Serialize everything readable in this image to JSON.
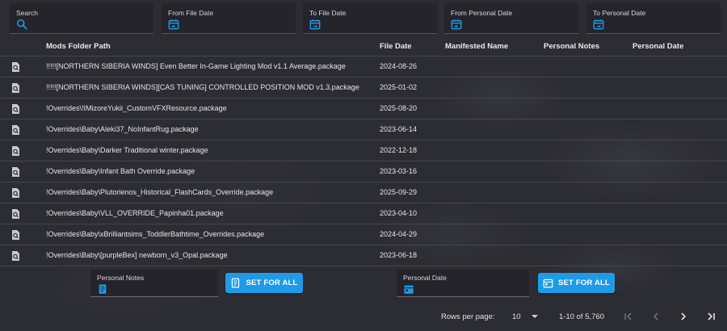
{
  "filters": {
    "search": {
      "label": "Search",
      "icon": "search-icon"
    },
    "from_file_date": {
      "label": "From File Date",
      "icon": "calendar-start-icon"
    },
    "to_file_date": {
      "label": "To File Date",
      "icon": "calendar-end-icon"
    },
    "from_personal_date": {
      "label": "From Personal Date",
      "icon": "calendar-start-icon"
    },
    "to_personal_date": {
      "label": "To Personal Date",
      "icon": "calendar-end-icon"
    }
  },
  "table": {
    "columns": [
      "Mods Folder Path",
      "File Date",
      "Manifested Name",
      "Personal Notes",
      "Personal Date"
    ],
    "rows": [
      {
        "path": "!!!!![NORTHERN SIBERIA WINDS] Even Better In-Game Lighting Mod v1.1 Average.package",
        "file_date": "2024-08-26"
      },
      {
        "path": "!!!!![NORTHERN SIBERIA WINDS][CAS TUNING] CONTROLLED POSITION MOD v1.3.package",
        "file_date": "2025-01-02"
      },
      {
        "path": "!Overrides\\!IMizoreYukii_CustomVFXResource.package",
        "file_date": "2025-08-20"
      },
      {
        "path": "!Overrides\\Baby\\Aleki37_NoInfantRug.package",
        "file_date": "2023-06-14"
      },
      {
        "path": "!Overrides\\Baby\\Darker Traditional winter.package",
        "file_date": "2022-12-18"
      },
      {
        "path": "!Overrides\\Baby\\Infant Bath Override.package",
        "file_date": "2023-03-16"
      },
      {
        "path": "!Overrides\\Baby\\Plutorienos_Historical_FlashCards_Override.package",
        "file_date": "2025-09-29"
      },
      {
        "path": "!Overrides\\Baby\\VLL_OVERRIDE_Papinha01.package",
        "file_date": "2023-04-10"
      },
      {
        "path": "!Overrides\\Baby\\xBrilliantsims_ToddlerBathtime_Overrides.package",
        "file_date": "2024-04-29"
      },
      {
        "path": "!Overrides\\Baby\\[purpleBex] newborn_v3_Opal.package",
        "file_date": "2023-06-18"
      }
    ]
  },
  "bulk": {
    "notes": {
      "label": "Personal Notes",
      "icon": "notes-icon",
      "button": "SET FOR ALL"
    },
    "date": {
      "label": "Personal Date",
      "icon": "calendar-icon",
      "button": "SET FOR ALL"
    }
  },
  "pagination": {
    "rows_per_page_label": "Rows per page:",
    "rows_per_page": "10",
    "range": "1-10 of 5,760"
  },
  "colors": {
    "accent": "#1e9be8",
    "background": "#2c2c33",
    "field": "#24242a"
  }
}
